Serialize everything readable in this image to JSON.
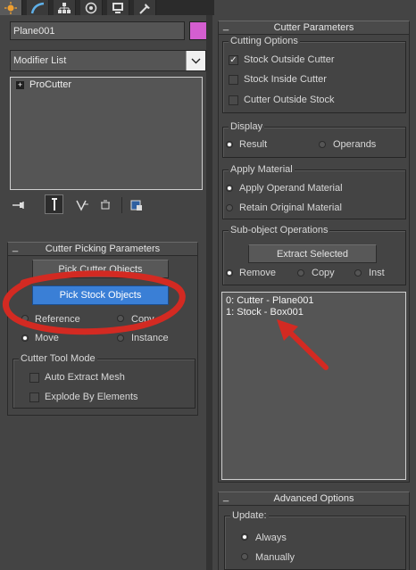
{
  "object_name": "Plane001",
  "object_color": "#d45ed0",
  "modifier_list": {
    "label": "Modifier List"
  },
  "stack": {
    "items": [
      {
        "label": "ProCutter"
      }
    ]
  },
  "cutter_picking": {
    "title": "Cutter Picking Parameters",
    "pick_cutter_label": "Pick Cutter Objects",
    "pick_stock_label": "Pick Stock Objects",
    "reference_label": "Reference",
    "copy_label": "Copy",
    "move_label": "Move",
    "instance_label": "Instance",
    "tool_mode_title": "Cutter Tool Mode",
    "auto_extract_label": "Auto Extract Mesh",
    "explode_label": "Explode By Elements"
  },
  "cutter_params": {
    "title": "Cutter Parameters",
    "cutting_options_title": "Cutting Options",
    "stock_outside_label": "Stock Outside Cutter",
    "stock_inside_label": "Stock Inside Cutter",
    "cutter_outside_label": "Cutter Outside Stock",
    "display_title": "Display",
    "result_label": "Result",
    "operands_label": "Operands",
    "apply_material_title": "Apply Material",
    "apply_operand_label": "Apply Operand Material",
    "retain_original_label": "Retain Original Material",
    "subobject_title": "Sub-object Operations",
    "extract_label": "Extract Selected",
    "remove_label": "Remove",
    "copy_label": "Copy",
    "inst_label": "Inst",
    "operand_list": [
      "0: Cutter - Plane001",
      "1: Stock - Box001"
    ]
  },
  "advanced": {
    "title": "Advanced Options",
    "update_title": "Update:",
    "always_label": "Always",
    "manually_label": "Manually"
  },
  "collapse_glyph": "_",
  "annotation_color": "#d32a22",
  "accent_color": "#3a7fd6"
}
